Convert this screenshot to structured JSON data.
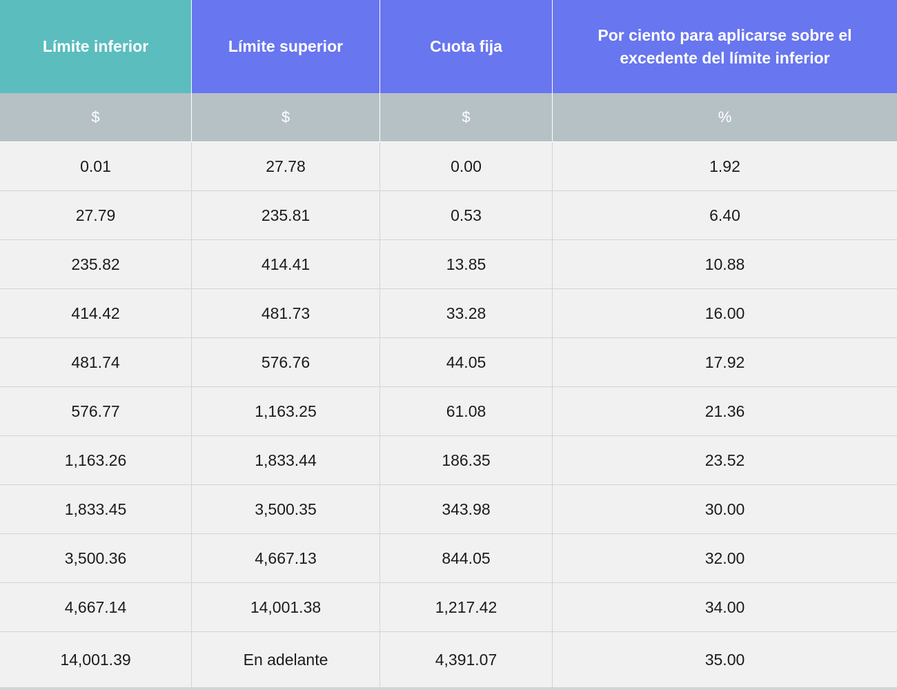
{
  "table": {
    "headers": [
      "Límite inferior",
      "Límite superior",
      "Cuota fija",
      "Por ciento para aplicarse sobre el excedente del límite inferior"
    ],
    "units": [
      "$",
      "$",
      "$",
      "%"
    ],
    "rows": [
      [
        "0.01",
        "27.78",
        "0.00",
        "1.92"
      ],
      [
        "27.79",
        "235.81",
        "0.53",
        "6.40"
      ],
      [
        "235.82",
        "414.41",
        "13.85",
        "10.88"
      ],
      [
        "414.42",
        "481.73",
        "33.28",
        "16.00"
      ],
      [
        "481.74",
        "576.76",
        "44.05",
        "17.92"
      ],
      [
        "576.77",
        "1,163.25",
        "61.08",
        "21.36"
      ],
      [
        "1,163.26",
        "1,833.44",
        "186.35",
        "23.52"
      ],
      [
        "1,833.45",
        "3,500.35",
        "343.98",
        "30.00"
      ],
      [
        "3,500.36",
        "4,667.13",
        "844.05",
        "32.00"
      ],
      [
        "4,667.14",
        "14,001.38",
        "1,217.42",
        "34.00"
      ],
      [
        "14,001.39",
        "En adelante",
        "4,391.07",
        "35.00"
      ]
    ]
  },
  "colors": {
    "header_first": "#5bbdbe",
    "header_rest": "#6876ef",
    "unit_row": "#b6c1c6",
    "data_row": "#f1f1f1",
    "text": "#1b1b1b"
  }
}
